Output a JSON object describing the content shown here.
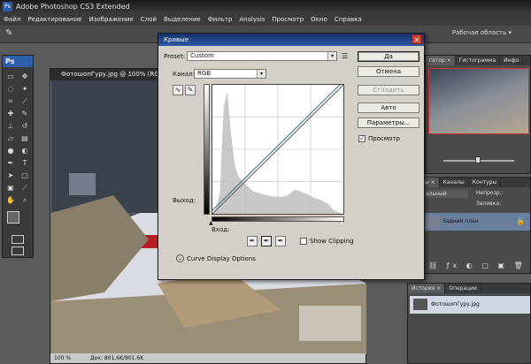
{
  "app": {
    "title": "Adobe Photoshop CS3 Extended",
    "logo": "Ps",
    "menu": [
      "Файл",
      "Редактирование",
      "Изображение",
      "Слой",
      "Выделение",
      "Фильтр",
      "Analysis",
      "Просмотр",
      "Окно",
      "Справка"
    ],
    "workspace": "Рабочая область ▾"
  },
  "document": {
    "title": "ФотошопГуру.jpg @ 100% (RGB/8#)",
    "status_zoom": "100 %",
    "status_doc": "Док: 801,6K/801,6K"
  },
  "navigator": {
    "tabs": [
      "гатор ×",
      "Гистограмма",
      "Инфо"
    ]
  },
  "layers": {
    "tabs": [
      "ы ×",
      "Каналы",
      "Контуры"
    ],
    "mode": "альный",
    "opacity_label": "Непрозр.:",
    "fill_label": "Заливка:",
    "layer_name": "Задний план"
  },
  "history": {
    "tabs": [
      "История ×",
      "Операции"
    ],
    "item": "ФотошопГуру.jpg"
  },
  "curves": {
    "title": "Кривые",
    "preset_label": "Preset:",
    "preset_value": "Custom",
    "channel_label": "Канал:",
    "channel_value": "RGB",
    "output_label": "Выход:",
    "input_label": "Вход:",
    "show_clipping": "Show Clipping",
    "curve_display_options": "Curve Display Options",
    "buttons": {
      "ok": "Да",
      "cancel": "Отмена",
      "smooth": "Сгладить",
      "auto": "Авто",
      "options": "Параметры...",
      "preview": "Просмотр"
    },
    "preview_checked": true
  },
  "chart_data": {
    "type": "line",
    "title": "",
    "xlabel": "Вход:",
    "ylabel": "Выход:",
    "xlim": [
      0,
      255
    ],
    "ylim": [
      0,
      255
    ],
    "series": [
      {
        "x": [
          0,
          255
        ],
        "y": [
          0,
          255
        ]
      },
      {
        "x": [
          0,
          255
        ],
        "y": [
          0,
          255
        ]
      }
    ],
    "histogram": [
      0,
      10,
      40,
      200,
      230,
      150,
      90,
      70,
      60,
      55,
      48,
      42,
      40,
      38,
      36,
      34,
      33,
      32,
      32,
      33,
      34,
      40,
      45,
      44,
      40,
      38,
      35,
      30,
      28,
      26,
      22,
      18,
      10,
      5,
      2,
      0
    ],
    "grid": true
  }
}
